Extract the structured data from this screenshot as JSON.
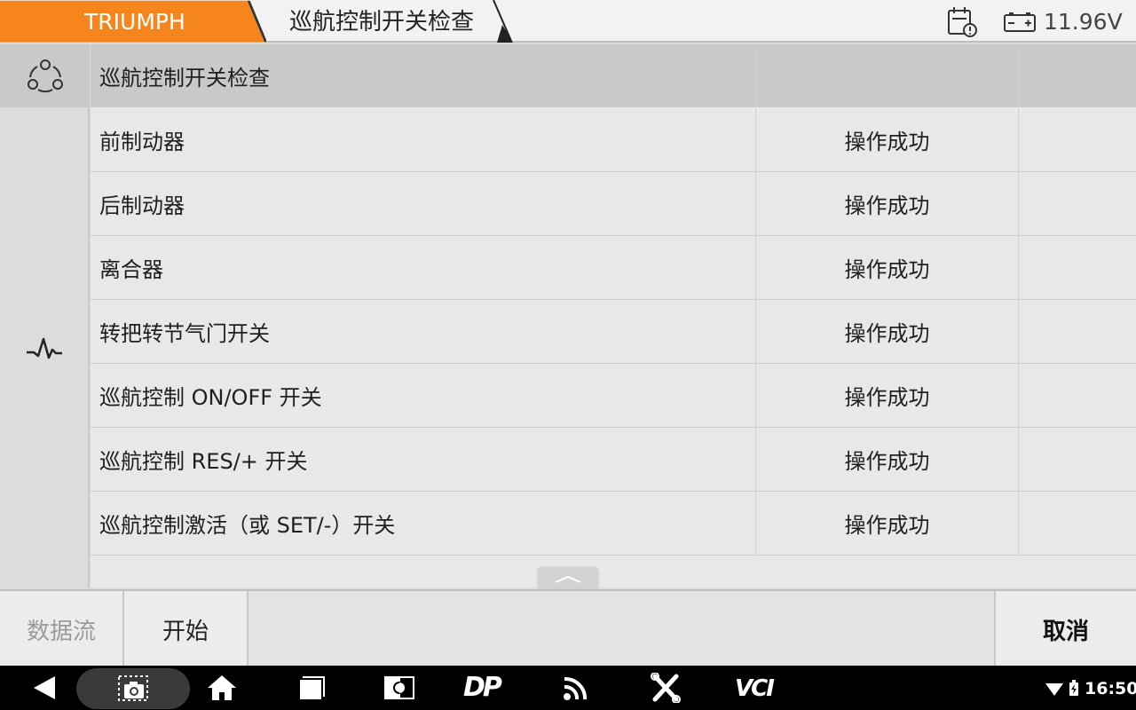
{
  "header": {
    "brand": "TRIUMPH",
    "breadcrumb": "巡航控制开关检查",
    "voltage": "11.96V",
    "report_icon": "report-clock-icon",
    "battery_icon": "battery-icon",
    "brand_color": "#f7851e"
  },
  "sidebar": {
    "top_icon": "group-icon",
    "mid_icon": "waveform-icon"
  },
  "table": {
    "title": "巡航控制开关检查",
    "rows": [
      {
        "name": "前制动器",
        "value": "操作成功"
      },
      {
        "name": "后制动器",
        "value": "操作成功"
      },
      {
        "name": "离合器",
        "value": "操作成功"
      },
      {
        "name": "转把转节气门开关",
        "value": "操作成功"
      },
      {
        "name": "巡航控制 ON/OFF 开关",
        "value": "操作成功"
      },
      {
        "name": "巡航控制 RES/+ 开关",
        "value": "操作成功"
      },
      {
        "name": "巡航控制激活（或 SET/-）开关",
        "value": "操作成功"
      }
    ]
  },
  "toolbar": {
    "datastream": "数据流",
    "start": "开始",
    "cancel": "取消"
  },
  "navbar": {
    "icons": [
      "back-icon",
      "screenshot-icon",
      "home-icon",
      "recents-icon",
      "brightness-icon",
      "dp-icon",
      "signal-icon",
      "tools-icon",
      "vci-icon"
    ],
    "dp_label": "DP",
    "vci_label": "VCI",
    "clock": "16:50"
  }
}
